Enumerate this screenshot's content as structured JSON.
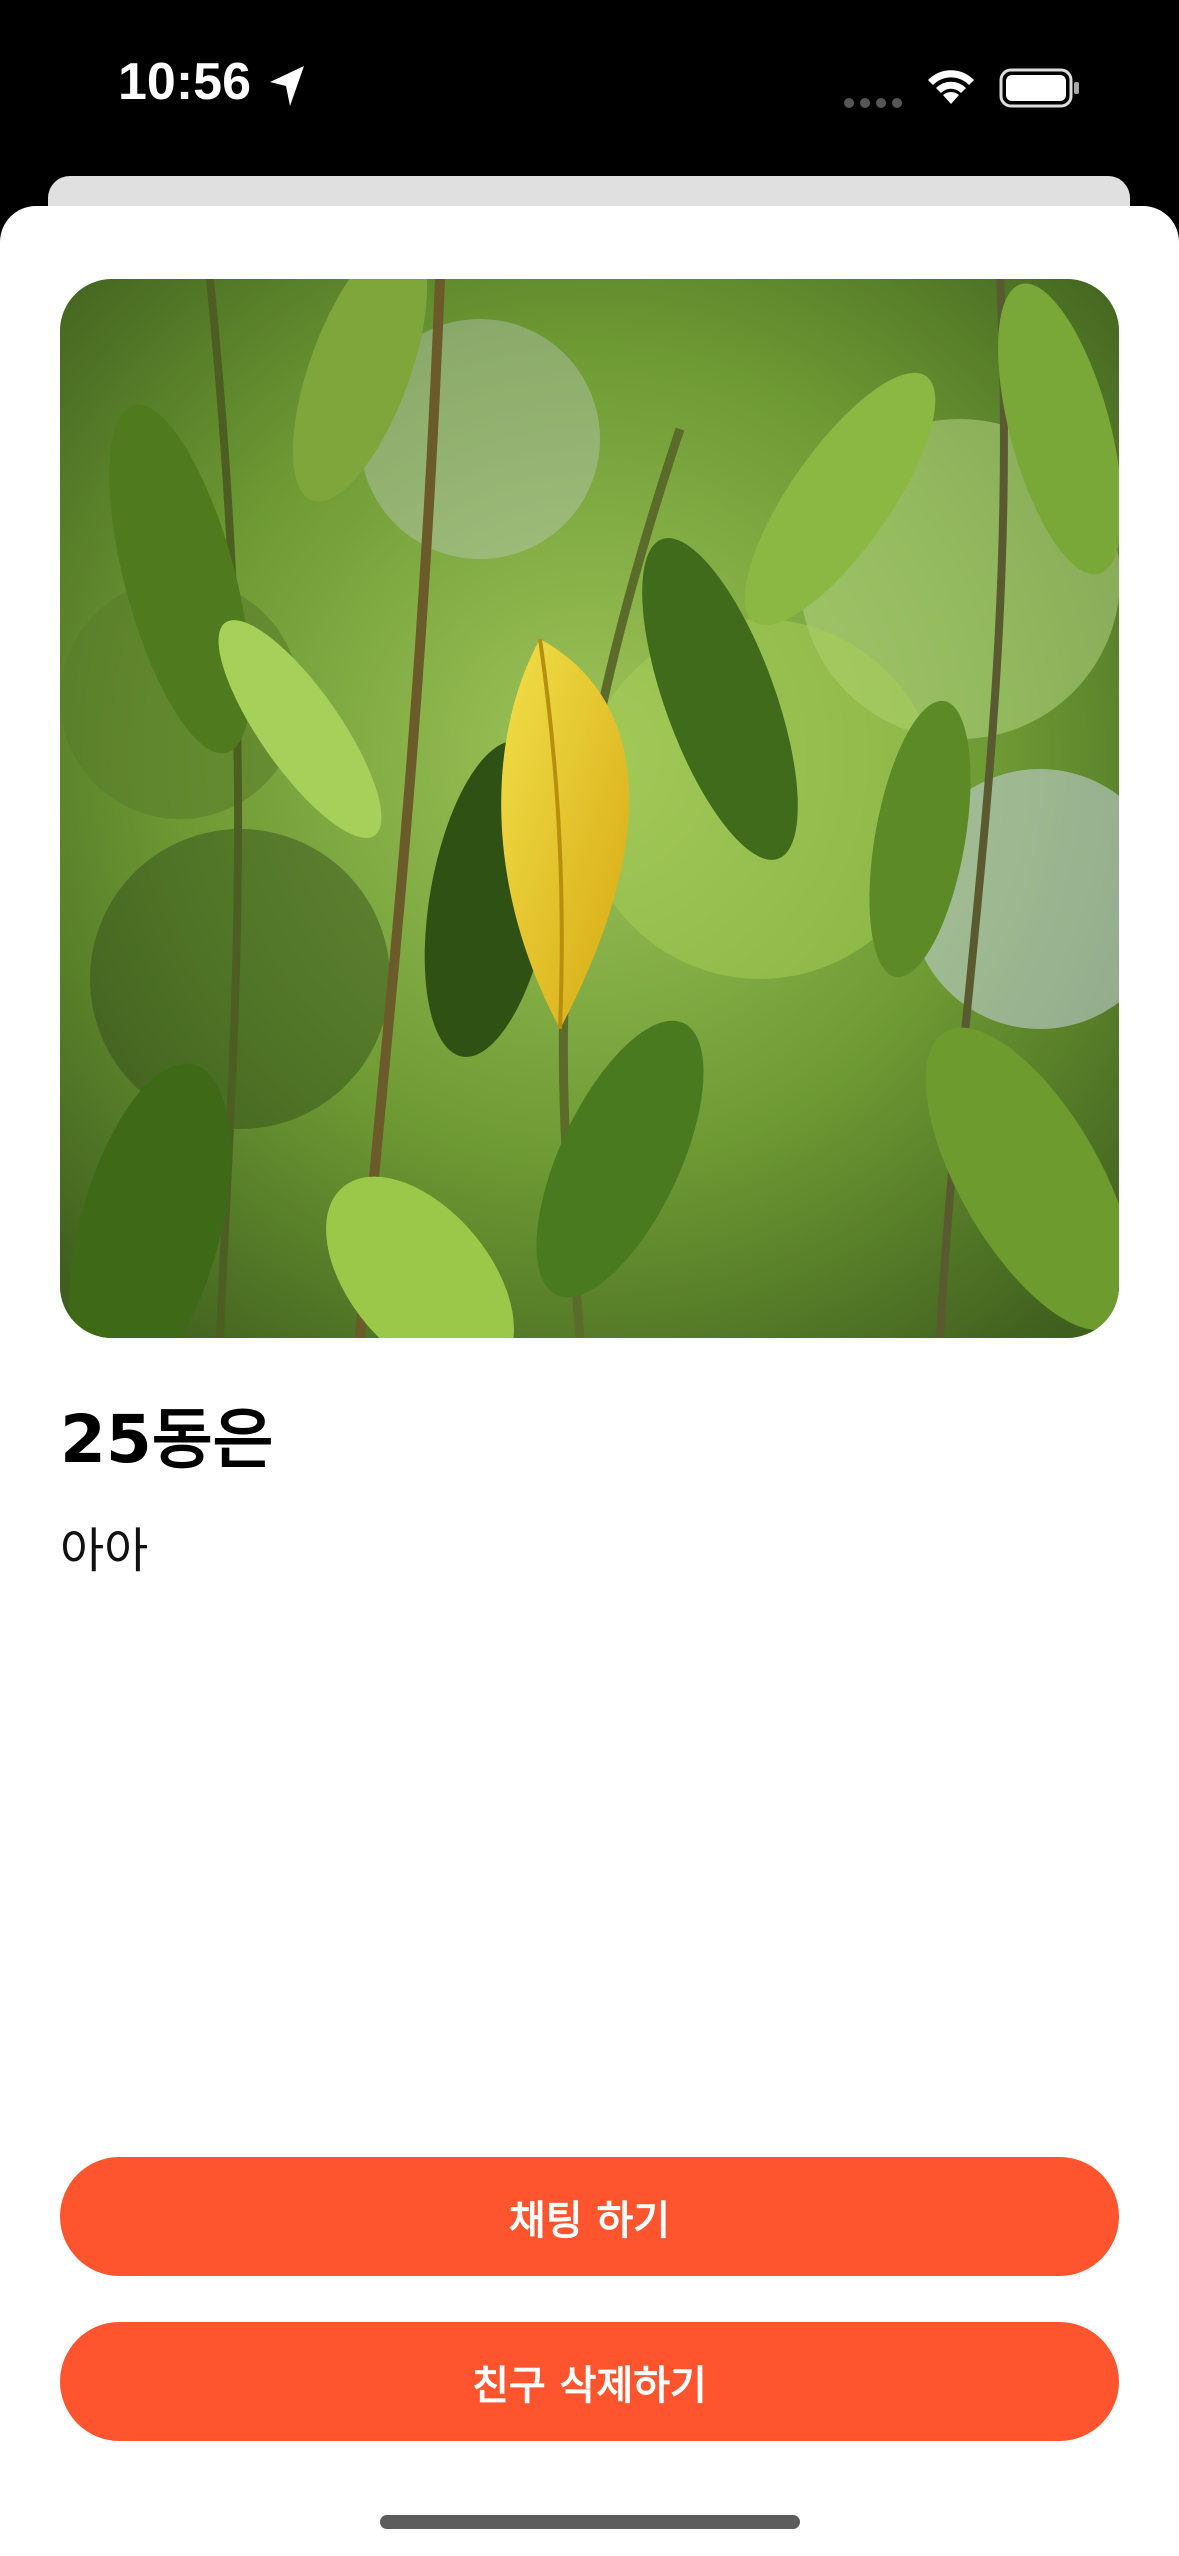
{
  "status_bar": {
    "time": "10:56",
    "icons": [
      "location-arrow-icon",
      "cellular-signal-icon",
      "wifi-icon",
      "battery-icon"
    ]
  },
  "profile": {
    "photo": "plant-leaves-photo",
    "name": "25동은",
    "status_message": "아아"
  },
  "actions": {
    "chat_label": "채팅 하기",
    "delete_friend_label": "친구 삭제하기"
  },
  "colors": {
    "accent": "#ff552f",
    "background": "#ffffff",
    "status_bar": "#000000"
  }
}
